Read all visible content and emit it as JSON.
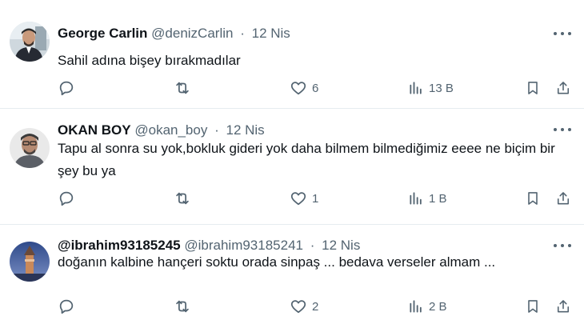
{
  "tweets": [
    {
      "name": "George Carlin",
      "handle": "@denizCarlin",
      "separator": "·",
      "date": "12 Nis",
      "text": "Sahil adına bişey bırakmadılar",
      "likes": "6",
      "views": "13 B",
      "avatar_colors": {
        "bg": "#cfd8de",
        "skin": "#c99a7c",
        "hair": "#2b2b2b",
        "shirt": "#262a33"
      }
    },
    {
      "name": "OKAN BOY",
      "handle": "@okan_boy",
      "separator": "·",
      "date": "12 Nis",
      "text": "Tapu al sonra su yok,bokluk gideri yok daha bilmem bilmediğimiz eeee ne biçim bir şey bu ya",
      "likes": "1",
      "views": "1 B",
      "avatar_colors": {
        "bg": "#e9e9e9",
        "skin": "#b58a72",
        "hair": "#3a3a3a",
        "shirt": "#5b5f66"
      }
    },
    {
      "name": "@ibrahim93185245",
      "handle": "@ibrahim93185241",
      "separator": "·",
      "date": "12 Nis",
      "text": "doğanın kalbine hançeri soktu orada sinpaş ... bedava verseler almam ...",
      "likes": "2",
      "views": "2 B",
      "avatar_colors": {
        "bg": "#3f5c9e",
        "tower": "#c9895a",
        "sky": "#7a8fc4"
      }
    }
  ],
  "icons": {
    "reply": "reply-icon",
    "retweet": "retweet-icon",
    "like": "heart-icon",
    "views": "views-icon",
    "bookmark": "bookmark-icon",
    "share": "share-icon",
    "more": "more-icon"
  },
  "colors": {
    "secondary_text": "#536471",
    "divider": "#e6ecf0"
  }
}
